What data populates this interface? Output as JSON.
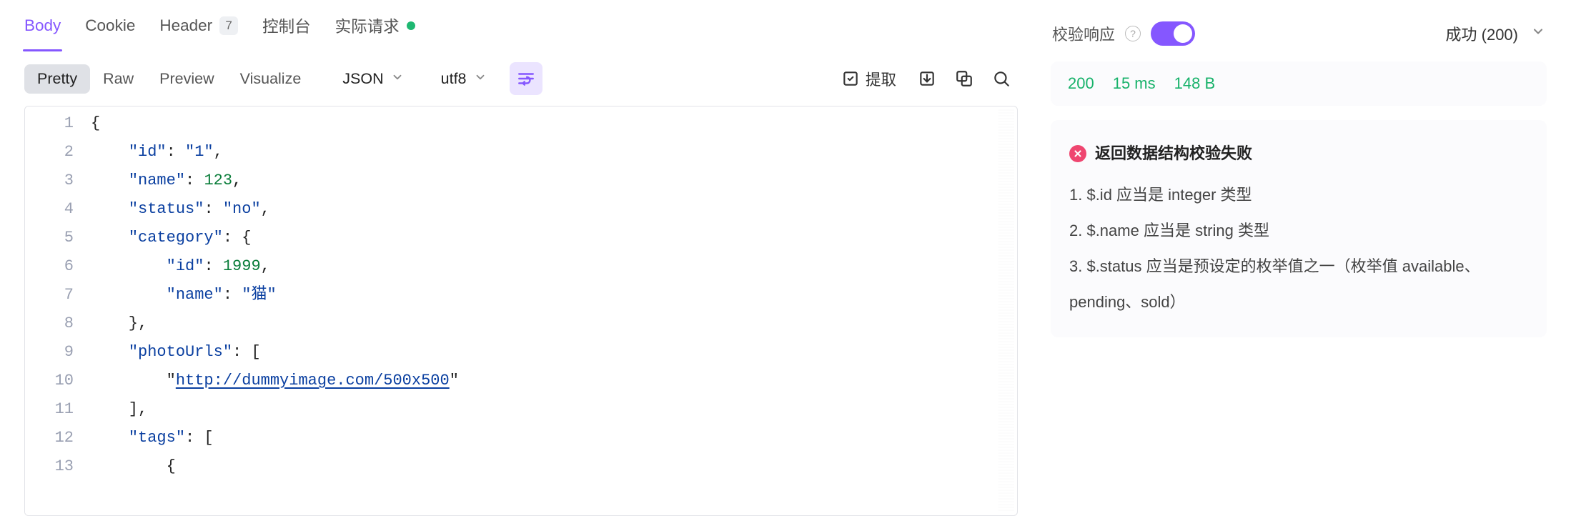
{
  "tabs": {
    "body": {
      "label": "Body"
    },
    "cookie": {
      "label": "Cookie"
    },
    "header": {
      "label": "Header",
      "badge": "7"
    },
    "console": {
      "label": "控制台"
    },
    "actual": {
      "label": "实际请求"
    }
  },
  "toolbar": {
    "view_modes": {
      "pretty": "Pretty",
      "raw": "Raw",
      "preview": "Preview",
      "visualize": "Visualize"
    },
    "format_dd": "JSON",
    "encoding_dd": "utf8",
    "extract_label": "提取"
  },
  "code": {
    "lines": [
      "{",
      "    \"id\": \"1\",",
      "    \"name\": 123,",
      "    \"status\": \"no\",",
      "    \"category\": {",
      "        \"id\": 1999,",
      "        \"name\": \"猫\"",
      "    },",
      "    \"photoUrls\": [",
      "        \"http://dummyimage.com/500x500\"",
      "    ],",
      "    \"tags\": [",
      "        {"
    ]
  },
  "side": {
    "verify_label": "校验响应",
    "status_label": "成功 (200)",
    "stats": {
      "code": "200",
      "time": "15 ms",
      "size": "148 B"
    },
    "error": {
      "title": "返回数据结构校验失败",
      "items": [
        "1. $.id 应当是 integer 类型",
        "2. $.name 应当是 string 类型",
        "3. $.status 应当是预设定的枚举值之一（枚举值 available、pending、sold）"
      ]
    }
  }
}
